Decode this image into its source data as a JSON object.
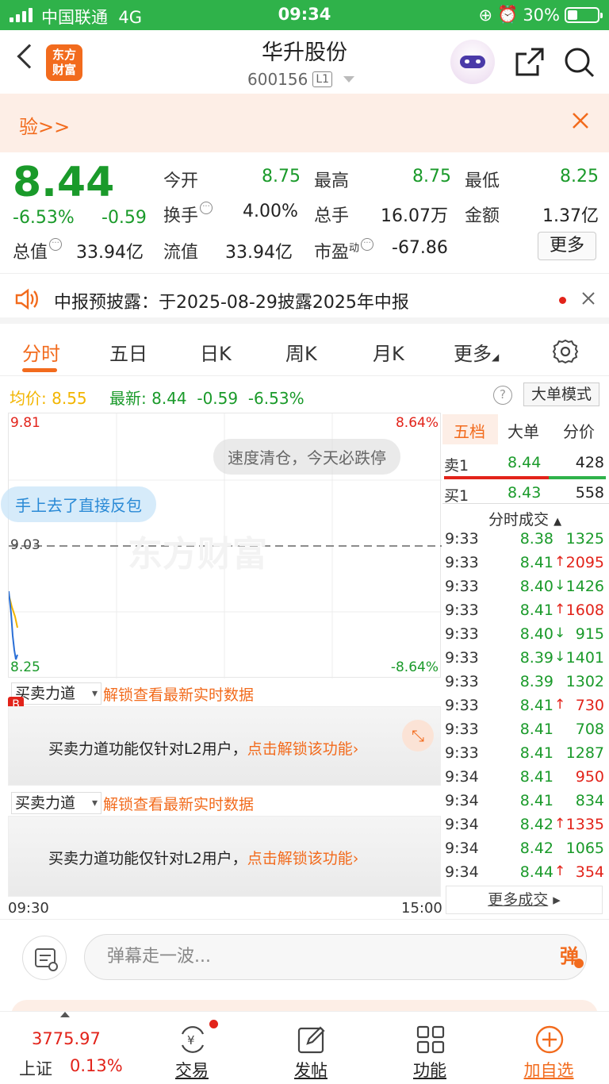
{
  "status": {
    "carrier": "中国联通",
    "network": "4G",
    "time": "09:34",
    "battery": "30%"
  },
  "header": {
    "logo_line1": "东方",
    "logo_line2": "财富",
    "title": "华升股份",
    "code": "600156",
    "level": "L1"
  },
  "banner": {
    "text": "验>>"
  },
  "quote": {
    "price": "8.44",
    "change_pct": "-6.53%",
    "change": "-0.59",
    "open_label": "今开",
    "open": "8.75",
    "high_label": "最高",
    "high": "8.75",
    "low_label": "最低",
    "low": "8.25",
    "turnover_label": "换手",
    "turnover": "4.00%",
    "volume_label": "总手",
    "volume": "16.07万",
    "amount_label": "金额",
    "amount": "1.37亿",
    "mktcap_label": "总值",
    "mktcap": "33.94亿",
    "float_label": "流值",
    "float": "33.94亿",
    "pe_label": "市盈",
    "pe_sup": "动",
    "pe": "-67.86",
    "more": "更多"
  },
  "notice": {
    "text": "中报预披露：于2025-08-29披露2025年中报"
  },
  "tabs": [
    "分时",
    "五日",
    "日K",
    "周K",
    "月K",
    "更多"
  ],
  "inforow": {
    "avg_label": "均价:",
    "avg": "8.55",
    "latest_label": "最新:",
    "latest": "8.44",
    "chg": "-0.59",
    "pct": "-6.53%",
    "mode": "大单模式"
  },
  "chart": {
    "y_top": "9.81",
    "y_mid": "9.03",
    "y_bottom": "8.25",
    "pct_top": "8.64%",
    "pct_bottom": "-8.64%",
    "time_start": "09:30",
    "time_end": "15:00",
    "watermark": "东方财富",
    "danmu1": "速度清仓，今天必跌停",
    "danmu2": "手上去了直接反包",
    "colors": {
      "price": "#2a6fd6",
      "avg": "#f2b500"
    }
  },
  "l2": {
    "select": "买卖力道",
    "unlock": "解锁查看最新实时数据",
    "body": "买卖力道功能仅针对L2用户，",
    "cta": "点击解锁该功能"
  },
  "book": {
    "tabs": [
      "五档",
      "大单",
      "分价"
    ],
    "sell1": {
      "label": "卖1",
      "price": "8.44",
      "vol": "428"
    },
    "buy1": {
      "label": "买1",
      "price": "8.43",
      "vol": "558"
    },
    "trades_title": "分时成交",
    "trades": [
      {
        "t": "9:33",
        "p": "8.38",
        "a": "",
        "v": "1325",
        "vc": "green"
      },
      {
        "t": "9:33",
        "p": "8.41",
        "a": "↑",
        "v": "2095",
        "vc": "red"
      },
      {
        "t": "9:33",
        "p": "8.40",
        "a": "↓",
        "v": "1426",
        "vc": "green"
      },
      {
        "t": "9:33",
        "p": "8.41",
        "a": "↑",
        "v": "1608",
        "vc": "red"
      },
      {
        "t": "9:33",
        "p": "8.40",
        "a": "↓",
        "v": "915",
        "vc": "green"
      },
      {
        "t": "9:33",
        "p": "8.39",
        "a": "↓",
        "v": "1401",
        "vc": "green"
      },
      {
        "t": "9:33",
        "p": "8.39",
        "a": "",
        "v": "1302",
        "vc": "green"
      },
      {
        "t": "9:33",
        "p": "8.41",
        "a": "↑",
        "v": "730",
        "vc": "red"
      },
      {
        "t": "9:33",
        "p": "8.41",
        "a": "",
        "v": "708",
        "vc": "green"
      },
      {
        "t": "9:33",
        "p": "8.41",
        "a": "",
        "v": "1287",
        "vc": "green"
      },
      {
        "t": "9:34",
        "p": "8.41",
        "a": "",
        "v": "950",
        "vc": "red"
      },
      {
        "t": "9:34",
        "p": "8.41",
        "a": "",
        "v": "834",
        "vc": "green"
      },
      {
        "t": "9:34",
        "p": "8.42",
        "a": "↑",
        "v": "1335",
        "vc": "red"
      },
      {
        "t": "9:34",
        "p": "8.42",
        "a": "",
        "v": "1065",
        "vc": "green"
      },
      {
        "t": "9:34",
        "p": "8.44",
        "a": "↑",
        "v": "354",
        "vc": "red"
      }
    ],
    "more": "更多成交"
  },
  "comment": {
    "placeholder": "弹幕走一波...",
    "dan": "弹"
  },
  "bottom": {
    "index_value": "3775.97",
    "index_name": "上证",
    "index_pct": "0.13%",
    "nav": [
      "交易",
      "发帖",
      "功能",
      "加自选"
    ]
  }
}
